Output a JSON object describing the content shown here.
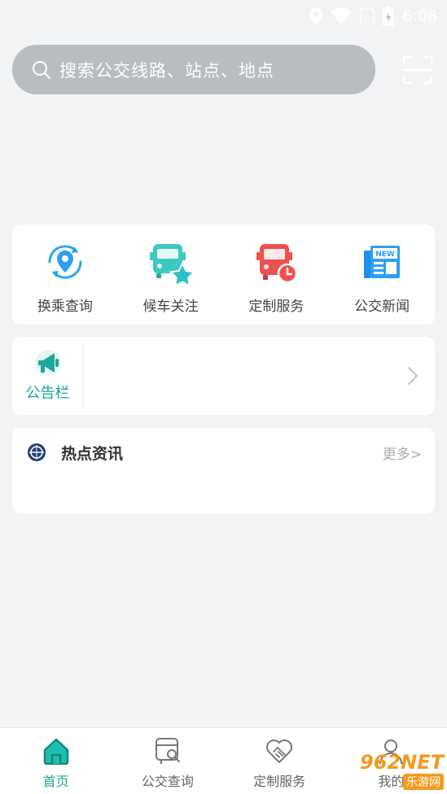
{
  "status_bar": {
    "time": "6:08"
  },
  "search": {
    "placeholder": "搜索公交线路、站点、地点"
  },
  "quick_menu": [
    {
      "label": "换乘查询",
      "icon": "transfer-location-icon"
    },
    {
      "label": "候车关注",
      "icon": "bus-star-icon"
    },
    {
      "label": "定制服务",
      "icon": "bus-clock-icon"
    },
    {
      "label": "公交新闻",
      "icon": "news-icon"
    }
  ],
  "notice": {
    "label": "公告栏",
    "icon": "megaphone-icon"
  },
  "hot_news": {
    "title": "热点资讯",
    "more": "更多>"
  },
  "tabbar": [
    {
      "label": "首页",
      "icon": "home-icon",
      "active": true
    },
    {
      "label": "公交查询",
      "icon": "bus-search-icon",
      "active": false
    },
    {
      "label": "定制服务",
      "icon": "handshake-icon",
      "active": false
    },
    {
      "label": "我的",
      "icon": "user-icon",
      "active": false
    }
  ],
  "watermark": {
    "brand": "962NET",
    "sub": "乐游网"
  },
  "colors": {
    "accent": "#1aa89a",
    "search_bg": "#b9bcc0",
    "background": "#f2f3f5"
  }
}
